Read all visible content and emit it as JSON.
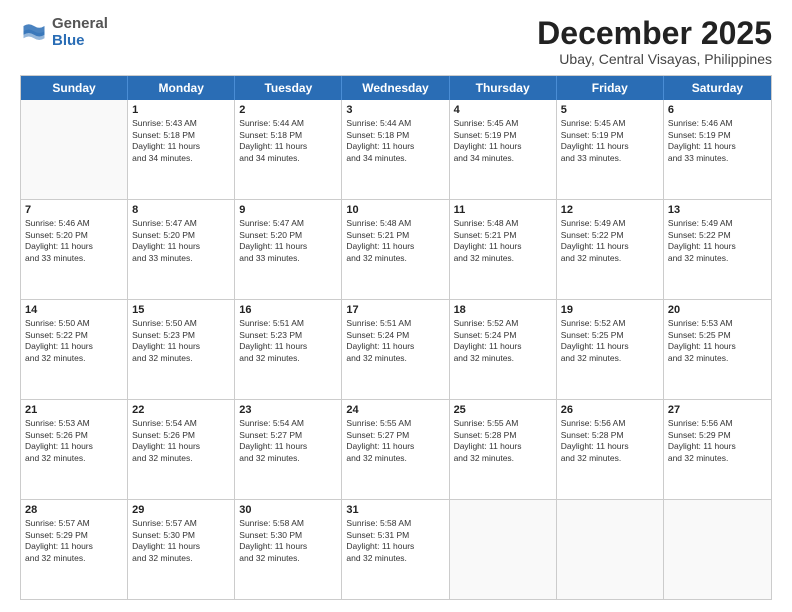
{
  "logo": {
    "general": "General",
    "blue": "Blue"
  },
  "header": {
    "month": "December 2025",
    "location": "Ubay, Central Visayas, Philippines"
  },
  "days": [
    "Sunday",
    "Monday",
    "Tuesday",
    "Wednesday",
    "Thursday",
    "Friday",
    "Saturday"
  ],
  "rows": [
    [
      {
        "day": "",
        "info": ""
      },
      {
        "day": "1",
        "info": "Sunrise: 5:43 AM\nSunset: 5:18 PM\nDaylight: 11 hours\nand 34 minutes."
      },
      {
        "day": "2",
        "info": "Sunrise: 5:44 AM\nSunset: 5:18 PM\nDaylight: 11 hours\nand 34 minutes."
      },
      {
        "day": "3",
        "info": "Sunrise: 5:44 AM\nSunset: 5:18 PM\nDaylight: 11 hours\nand 34 minutes."
      },
      {
        "day": "4",
        "info": "Sunrise: 5:45 AM\nSunset: 5:19 PM\nDaylight: 11 hours\nand 34 minutes."
      },
      {
        "day": "5",
        "info": "Sunrise: 5:45 AM\nSunset: 5:19 PM\nDaylight: 11 hours\nand 33 minutes."
      },
      {
        "day": "6",
        "info": "Sunrise: 5:46 AM\nSunset: 5:19 PM\nDaylight: 11 hours\nand 33 minutes."
      }
    ],
    [
      {
        "day": "7",
        "info": "Sunrise: 5:46 AM\nSunset: 5:20 PM\nDaylight: 11 hours\nand 33 minutes."
      },
      {
        "day": "8",
        "info": "Sunrise: 5:47 AM\nSunset: 5:20 PM\nDaylight: 11 hours\nand 33 minutes."
      },
      {
        "day": "9",
        "info": "Sunrise: 5:47 AM\nSunset: 5:20 PM\nDaylight: 11 hours\nand 33 minutes."
      },
      {
        "day": "10",
        "info": "Sunrise: 5:48 AM\nSunset: 5:21 PM\nDaylight: 11 hours\nand 32 minutes."
      },
      {
        "day": "11",
        "info": "Sunrise: 5:48 AM\nSunset: 5:21 PM\nDaylight: 11 hours\nand 32 minutes."
      },
      {
        "day": "12",
        "info": "Sunrise: 5:49 AM\nSunset: 5:22 PM\nDaylight: 11 hours\nand 32 minutes."
      },
      {
        "day": "13",
        "info": "Sunrise: 5:49 AM\nSunset: 5:22 PM\nDaylight: 11 hours\nand 32 minutes."
      }
    ],
    [
      {
        "day": "14",
        "info": "Sunrise: 5:50 AM\nSunset: 5:22 PM\nDaylight: 11 hours\nand 32 minutes."
      },
      {
        "day": "15",
        "info": "Sunrise: 5:50 AM\nSunset: 5:23 PM\nDaylight: 11 hours\nand 32 minutes."
      },
      {
        "day": "16",
        "info": "Sunrise: 5:51 AM\nSunset: 5:23 PM\nDaylight: 11 hours\nand 32 minutes."
      },
      {
        "day": "17",
        "info": "Sunrise: 5:51 AM\nSunset: 5:24 PM\nDaylight: 11 hours\nand 32 minutes."
      },
      {
        "day": "18",
        "info": "Sunrise: 5:52 AM\nSunset: 5:24 PM\nDaylight: 11 hours\nand 32 minutes."
      },
      {
        "day": "19",
        "info": "Sunrise: 5:52 AM\nSunset: 5:25 PM\nDaylight: 11 hours\nand 32 minutes."
      },
      {
        "day": "20",
        "info": "Sunrise: 5:53 AM\nSunset: 5:25 PM\nDaylight: 11 hours\nand 32 minutes."
      }
    ],
    [
      {
        "day": "21",
        "info": "Sunrise: 5:53 AM\nSunset: 5:26 PM\nDaylight: 11 hours\nand 32 minutes."
      },
      {
        "day": "22",
        "info": "Sunrise: 5:54 AM\nSunset: 5:26 PM\nDaylight: 11 hours\nand 32 minutes."
      },
      {
        "day": "23",
        "info": "Sunrise: 5:54 AM\nSunset: 5:27 PM\nDaylight: 11 hours\nand 32 minutes."
      },
      {
        "day": "24",
        "info": "Sunrise: 5:55 AM\nSunset: 5:27 PM\nDaylight: 11 hours\nand 32 minutes."
      },
      {
        "day": "25",
        "info": "Sunrise: 5:55 AM\nSunset: 5:28 PM\nDaylight: 11 hours\nand 32 minutes."
      },
      {
        "day": "26",
        "info": "Sunrise: 5:56 AM\nSunset: 5:28 PM\nDaylight: 11 hours\nand 32 minutes."
      },
      {
        "day": "27",
        "info": "Sunrise: 5:56 AM\nSunset: 5:29 PM\nDaylight: 11 hours\nand 32 minutes."
      }
    ],
    [
      {
        "day": "28",
        "info": "Sunrise: 5:57 AM\nSunset: 5:29 PM\nDaylight: 11 hours\nand 32 minutes."
      },
      {
        "day": "29",
        "info": "Sunrise: 5:57 AM\nSunset: 5:30 PM\nDaylight: 11 hours\nand 32 minutes."
      },
      {
        "day": "30",
        "info": "Sunrise: 5:58 AM\nSunset: 5:30 PM\nDaylight: 11 hours\nand 32 minutes."
      },
      {
        "day": "31",
        "info": "Sunrise: 5:58 AM\nSunset: 5:31 PM\nDaylight: 11 hours\nand 32 minutes."
      },
      {
        "day": "",
        "info": ""
      },
      {
        "day": "",
        "info": ""
      },
      {
        "day": "",
        "info": ""
      }
    ]
  ]
}
